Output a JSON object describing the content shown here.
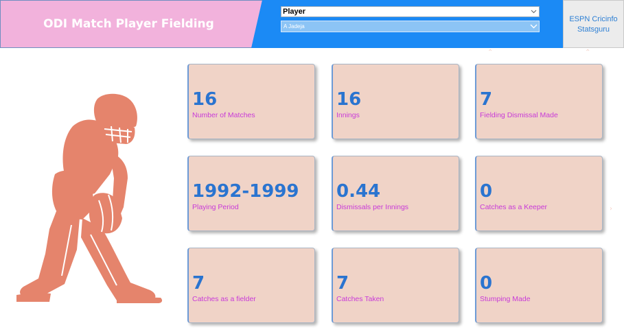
{
  "header": {
    "title": "ODI Match Player Fielding",
    "field_select": "Player",
    "player_select": "A Jadeja",
    "link_line1": "ESPN Cricinfo",
    "link_line2": "Statsguru"
  },
  "colors": {
    "title_bg": "#f2b2dc",
    "header_blue": "#1b8af5",
    "card_bg": "#f0d3c7",
    "value_blue": "#2a74d0",
    "label_magenta": "#c83ad8",
    "silhouette": "#e5846c"
  },
  "icons": [
    "chevron-down-icon",
    "cricket-wicketkeeper-silhouette"
  ],
  "cards": [
    {
      "value": "16",
      "label": "Number of Matches"
    },
    {
      "value": "16",
      "label": "Innings"
    },
    {
      "value": "7",
      "label": "Fielding Dismissal Made"
    },
    {
      "value": "1992-1999",
      "label": "Playing Period"
    },
    {
      "value": "0.44",
      "label": "Dismissals per Innings"
    },
    {
      "value": "0",
      "label": "Catches as a Keeper"
    },
    {
      "value": "7",
      "label": "Catches as a fielder"
    },
    {
      "value": "7",
      "label": "Catches Taken"
    },
    {
      "value": "0",
      "label": "Stumping Made"
    }
  ]
}
